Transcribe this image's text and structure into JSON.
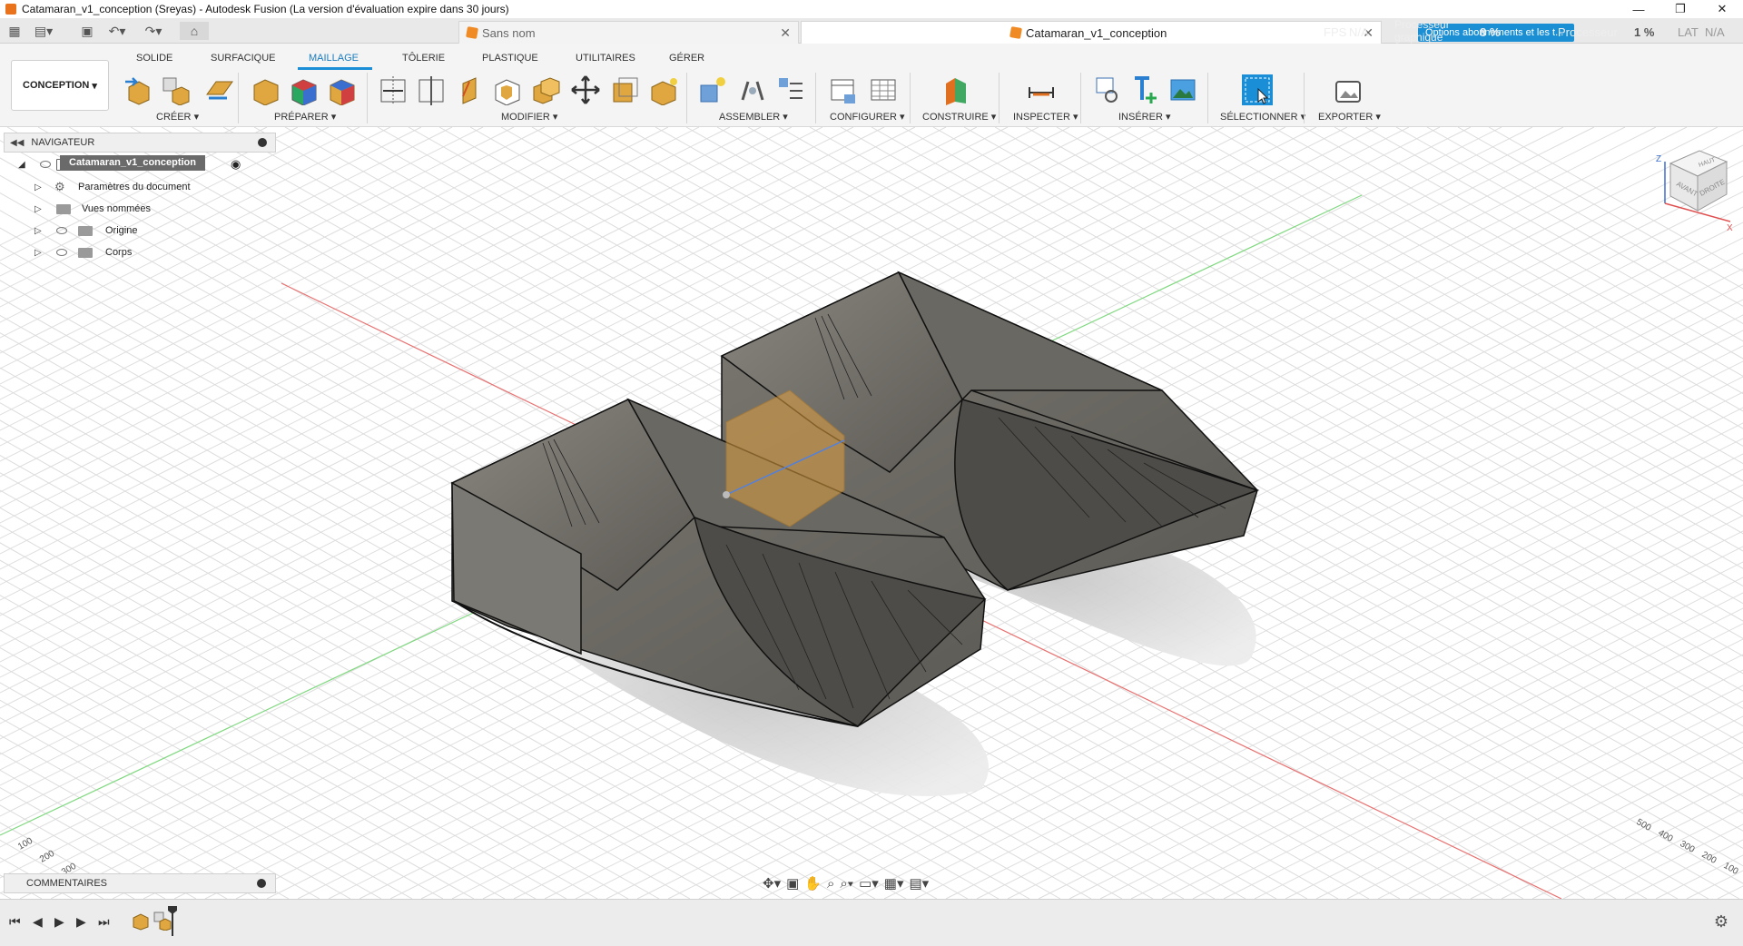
{
  "window": {
    "title": "Catamaran_v1_conception (Sreyas) - Autodesk Fusion (La version d'évaluation expire dans 30 jours)",
    "controls": {
      "minimize": "—",
      "restore": "❐",
      "close": "✕"
    }
  },
  "tabs": [
    {
      "label": "Sans nom",
      "active": false
    },
    {
      "label": "Catamaran_v1_conception",
      "active": true
    }
  ],
  "perf_overlay": {
    "fps_label": "FPS",
    "fps_value": "N/A",
    "gpu_label": "Processeur graphique",
    "gpu_value": "8 %",
    "cpu_label": "Processeur",
    "cpu_value": "1 %",
    "lat_label": "LAT",
    "lat_value": "N/A"
  },
  "trial_button": {
    "label": "Options abonnements et les t..."
  },
  "ribbon": {
    "workspace": "CONCEPTION",
    "tabs": [
      "SOLIDE",
      "SURFACIQUE",
      "MAILLAGE",
      "TÔLERIE",
      "PLASTIQUE",
      "UTILITAIRES",
      "GÉRER"
    ],
    "active_tab": "MAILLAGE",
    "groups": [
      {
        "label": "CRÉER"
      },
      {
        "label": "PRÉPARER"
      },
      {
        "label": "MODIFIER"
      },
      {
        "label": "ASSEMBLER"
      },
      {
        "label": "CONFIGURER"
      },
      {
        "label": "CONSTRUIRE"
      },
      {
        "label": "INSPECTER"
      },
      {
        "label": "INSÉRER"
      },
      {
        "label": "SÉLECTIONNER"
      },
      {
        "label": "EXPORTER"
      }
    ]
  },
  "browser": {
    "title": "NAVIGATEUR",
    "root": "Catamaran_v1_conception",
    "items": [
      {
        "label": "Paramètres du document"
      },
      {
        "label": "Vues nommées"
      },
      {
        "label": "Origine"
      },
      {
        "label": "Corps"
      }
    ]
  },
  "comments": {
    "title": "COMMENTAIRES"
  },
  "viewcube": {
    "top": "HAUT",
    "front": "AVANT",
    "right": "DROITE",
    "axis_x": "X",
    "axis_z": "Z"
  },
  "grid_labels": {
    "left": [
      "100",
      "200",
      "300"
    ],
    "right": [
      "100",
      "200",
      "300",
      "400",
      "500"
    ]
  },
  "colors": {
    "accent": "#1a8fd8",
    "model_fill": "#6f6d66",
    "model_edge": "#111111",
    "axis_x": "#e06060",
    "axis_y": "#70d070",
    "grid": "#d8d8d8"
  }
}
